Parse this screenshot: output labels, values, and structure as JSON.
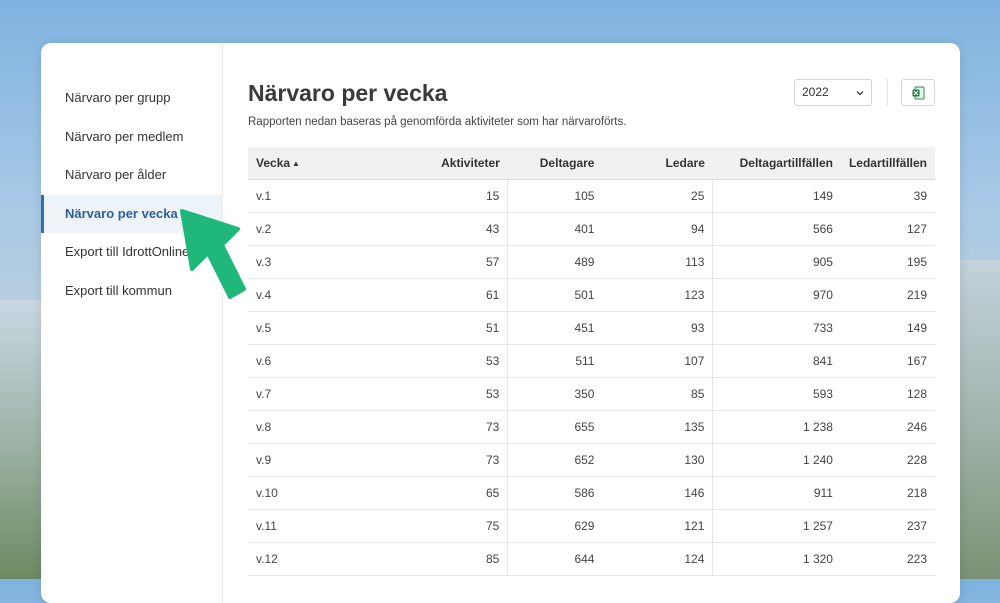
{
  "sidebar": {
    "items": [
      {
        "label": "Närvaro per grupp"
      },
      {
        "label": "Närvaro per medlem"
      },
      {
        "label": "Närvaro per ålder"
      },
      {
        "label": "Närvaro per vecka"
      },
      {
        "label": "Export till IdrottOnline"
      },
      {
        "label": "Export till kommun"
      }
    ],
    "active_index": 3
  },
  "main": {
    "title": "Närvaro per vecka",
    "subtitle": "Rapporten nedan baseras på genomförda aktiviteter som har närvaroförts.",
    "year_select": {
      "value": "2022",
      "icon": "chevron-down-icon"
    },
    "export_button": {
      "icon": "excel-icon",
      "color": "#1f7a3e"
    }
  },
  "table": {
    "headers": [
      "Vecka",
      "Aktiviteter",
      "Deltagare",
      "Ledare",
      "Deltagartillfällen",
      "Ledartillfällen"
    ],
    "sort_indicator": "▲",
    "rows": [
      [
        "v.1",
        "15",
        "105",
        "25",
        "149",
        "39"
      ],
      [
        "v.2",
        "43",
        "401",
        "94",
        "566",
        "127"
      ],
      [
        "v.3",
        "57",
        "489",
        "113",
        "905",
        "195"
      ],
      [
        "v.4",
        "61",
        "501",
        "123",
        "970",
        "219"
      ],
      [
        "v.5",
        "51",
        "451",
        "93",
        "733",
        "149"
      ],
      [
        "v.6",
        "53",
        "511",
        "107",
        "841",
        "167"
      ],
      [
        "v.7",
        "53",
        "350",
        "85",
        "593",
        "128"
      ],
      [
        "v.8",
        "73",
        "655",
        "135",
        "1 238",
        "246"
      ],
      [
        "v.9",
        "73",
        "652",
        "130",
        "1 240",
        "228"
      ],
      [
        "v.10",
        "65",
        "586",
        "146",
        "911",
        "218"
      ],
      [
        "v.11",
        "75",
        "629",
        "121",
        "1 257",
        "237"
      ],
      [
        "v.12",
        "85",
        "644",
        "124",
        "1 320",
        "223"
      ]
    ]
  },
  "annotation": {
    "icon": "pointer-arrow-icon",
    "color": "#1fb87a"
  },
  "colors": {
    "accent": "#2f6fb0",
    "active_bg": "#eef3f8",
    "arrow": "#1fb87a"
  }
}
